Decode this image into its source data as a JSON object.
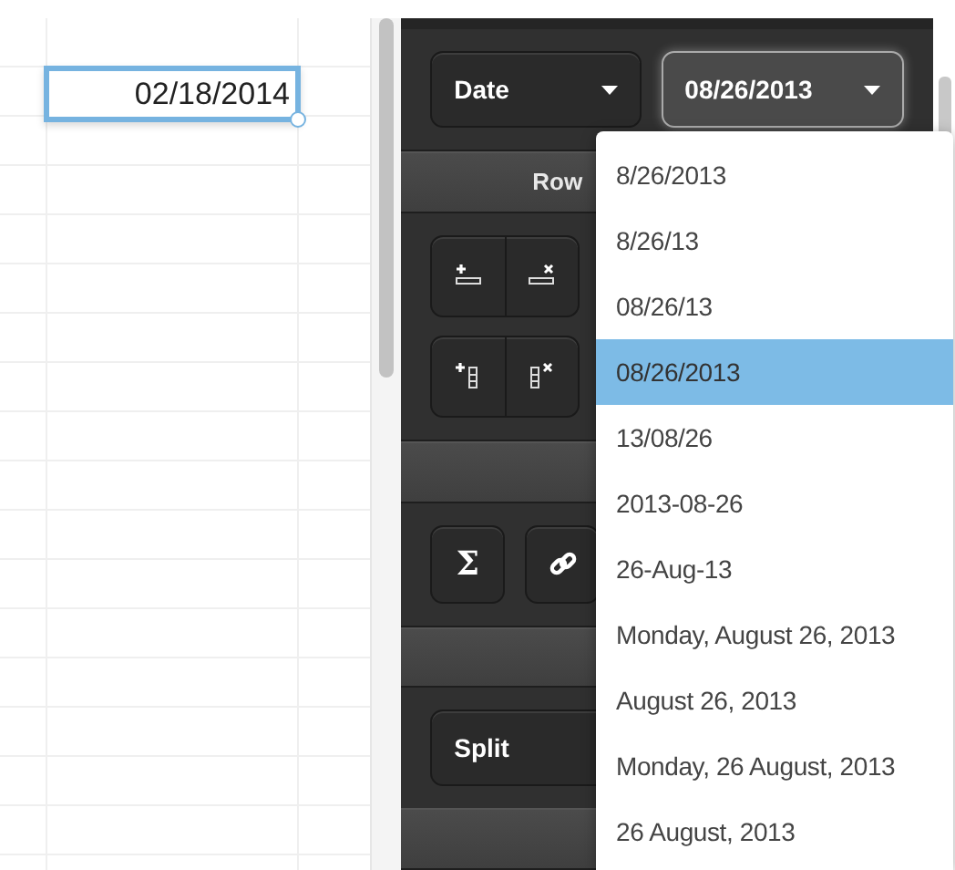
{
  "sheet": {
    "selected_cell": {
      "value": "02/18/2014"
    }
  },
  "panel": {
    "type_select": {
      "value": "Date"
    },
    "format_select": {
      "value": "08/26/2013",
      "expanded": true
    },
    "rows_header": {
      "title": "Row"
    },
    "sum_button": {
      "label": "Σ"
    },
    "split_select": {
      "value": "Split"
    }
  },
  "format_menu": {
    "items": [
      {
        "label": "8/26/2013",
        "selected": false
      },
      {
        "label": "8/26/13",
        "selected": false
      },
      {
        "label": "08/26/13",
        "selected": false
      },
      {
        "label": "08/26/2013",
        "selected": true
      },
      {
        "label": "13/08/26",
        "selected": false
      },
      {
        "label": "2013-08-26",
        "selected": false
      },
      {
        "label": "26-Aug-13",
        "selected": false
      },
      {
        "label": "Monday, August 26, 2013",
        "selected": false
      },
      {
        "label": "August 26, 2013",
        "selected": false
      },
      {
        "label": "Monday, 26 August, 2013",
        "selected": false
      },
      {
        "label": "26 August, 2013",
        "selected": false
      }
    ]
  }
}
